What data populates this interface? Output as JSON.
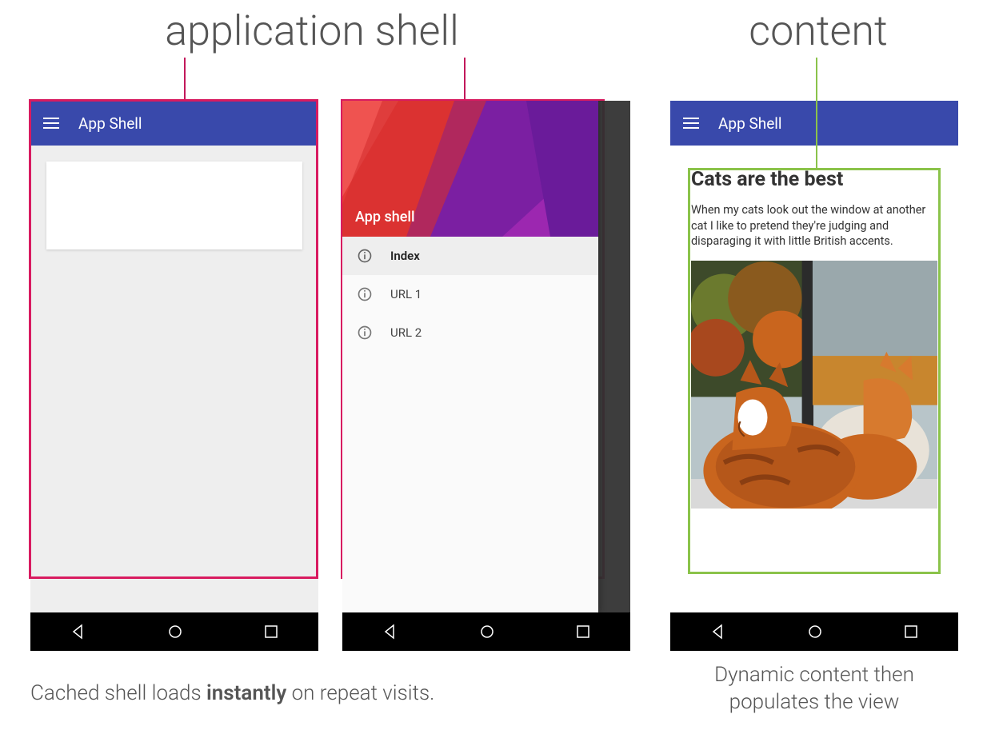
{
  "labels": {
    "app_shell": "application shell",
    "content": "content"
  },
  "appbar_title": "App Shell",
  "drawer": {
    "title": "App shell",
    "items": [
      {
        "label": "Index",
        "active": true
      },
      {
        "label": "URL 1",
        "active": false
      },
      {
        "label": "URL 2",
        "active": false
      }
    ]
  },
  "article": {
    "title": "Cats are the best",
    "body": "When my cats look out the window at another cat I like to pretend they're judging and disparaging it with little British accents."
  },
  "captions": {
    "left_pre": "Cached shell loads ",
    "left_bold": "instantly",
    "left_post": " on repeat visits.",
    "right": "Dynamic content then populates the view"
  },
  "colors": {
    "primary": "#3949ab",
    "highlight_red": "#d81b60",
    "highlight_green": "#8bc34a"
  }
}
